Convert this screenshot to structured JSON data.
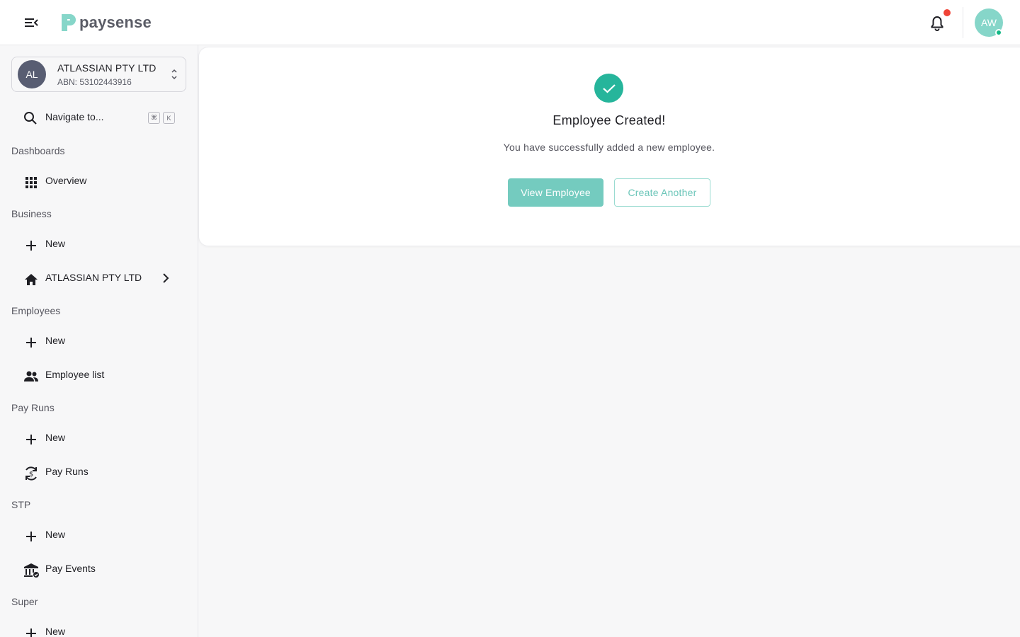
{
  "header": {
    "logo_text": "paysense",
    "user_initials": "AW",
    "brand_color": "#26b59b",
    "notification_dot_color": "#f04438"
  },
  "org": {
    "initials": "AL",
    "name": "ATLASSIAN PTY LTD",
    "abn": "ABN: 53102443916"
  },
  "search": {
    "label": "Navigate to...",
    "shortcut_keys": [
      "⌘",
      "K"
    ]
  },
  "sidebar": {
    "sections": [
      {
        "title": "Dashboards",
        "items": [
          {
            "label": "Overview",
            "icon": "grid-icon"
          }
        ]
      },
      {
        "title": "Business",
        "items": [
          {
            "label": "New",
            "icon": "plus-icon"
          },
          {
            "label": "ATLASSIAN PTY LTD",
            "icon": "home-icon"
          }
        ]
      },
      {
        "title": "Employees",
        "items": [
          {
            "label": "New",
            "icon": "plus-icon"
          },
          {
            "label": "Employee list",
            "icon": "people-icon"
          }
        ]
      },
      {
        "title": "Pay Runs",
        "items": [
          {
            "label": "New",
            "icon": "plus-icon"
          },
          {
            "label": "Pay Runs",
            "icon": "currency-exchange-icon"
          }
        ]
      },
      {
        "title": "STP",
        "items": [
          {
            "label": "New",
            "icon": "plus-icon"
          },
          {
            "label": "Pay Events",
            "icon": "bank-check-icon"
          }
        ]
      },
      {
        "title": "Super",
        "items": [
          {
            "label": "New",
            "icon": "plus-icon"
          }
        ]
      }
    ]
  },
  "main": {
    "title": "Employee Created!",
    "subtitle": "You have successfully added a new employee.",
    "primary_button": "View Employee",
    "secondary_button": "Create Another"
  }
}
